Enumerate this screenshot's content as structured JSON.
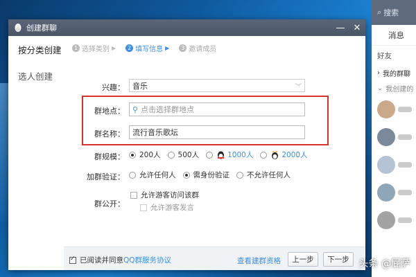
{
  "window": {
    "title": "创建群聊"
  },
  "sidebar": {
    "items": [
      {
        "label": "按分类创建"
      },
      {
        "label": "选人创建"
      }
    ]
  },
  "steps": [
    {
      "num": "1",
      "label": "选择类别"
    },
    {
      "num": "2",
      "label": "填写信息"
    },
    {
      "num": "3",
      "label": "邀请成员"
    }
  ],
  "form": {
    "interest": {
      "label": "兴趣：",
      "value": "音乐"
    },
    "location": {
      "label": "群地点：",
      "placeholder": "点击选择群地点"
    },
    "name": {
      "label": "群名称：",
      "value": "流行音乐歌坛"
    },
    "size": {
      "label": "群规模：",
      "options": [
        "200人",
        "500人",
        "1000人",
        "2000人"
      ],
      "selected": "200人"
    },
    "verify": {
      "label": "加群验证：",
      "options": [
        "允许任何人",
        "需身份验证",
        "不允许任何人"
      ],
      "selected": "需身份验证"
    },
    "public": {
      "label": "群公开：",
      "guest_read": "允许游客访问该群",
      "guest_post": "允许游客发言"
    }
  },
  "footer": {
    "agree_prefix": "已阅读并同意",
    "agree_link": "QQ群服务协议",
    "qualification": "查看建群资格",
    "prev": "上一步",
    "next": "下一步"
  },
  "qq_panel": {
    "search": "搜索",
    "tab": "消息",
    "sub": "好友",
    "group_mine": "我的群聊",
    "group_other": "我创建的"
  },
  "watermark": "头条 @屁萨",
  "colors": {
    "accent": "#3a8ee6",
    "highlight_box": "#d9322c",
    "titlebar": "#4a5566"
  }
}
